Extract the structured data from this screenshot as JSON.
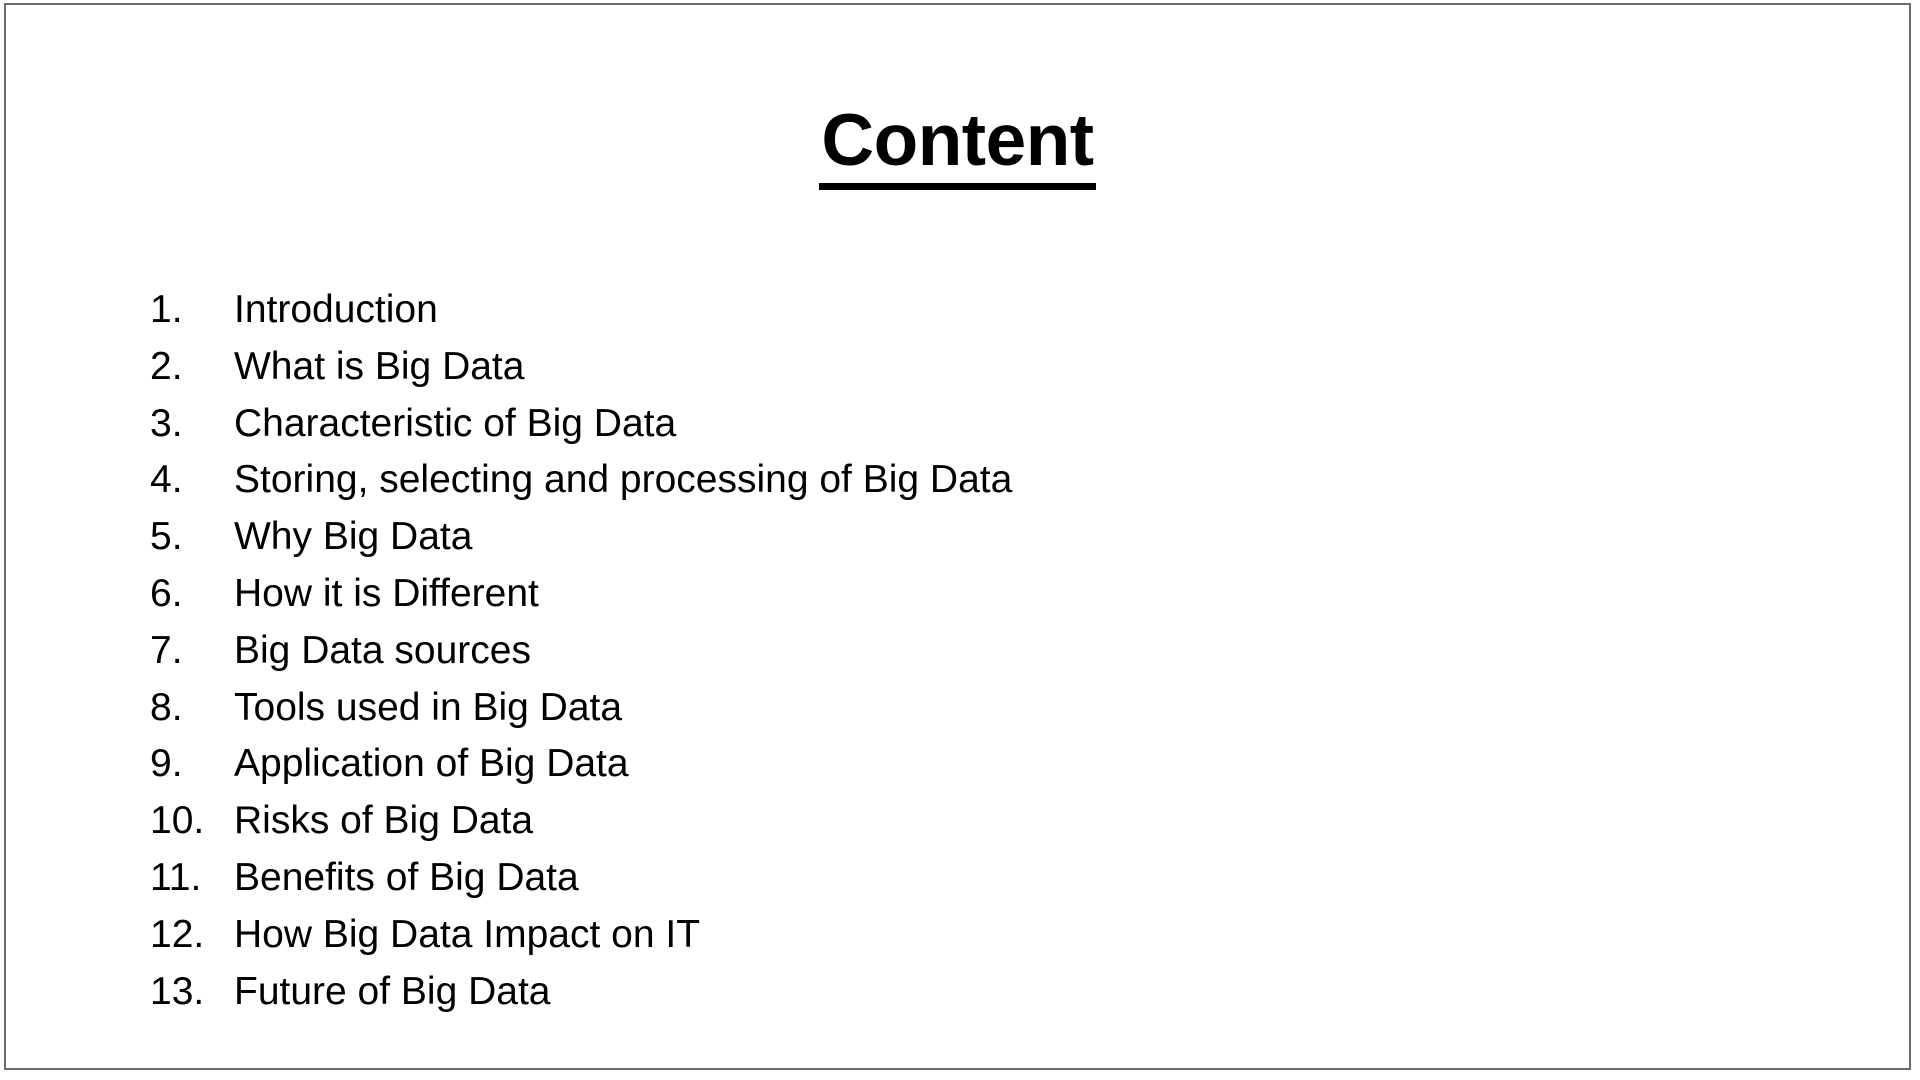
{
  "slide": {
    "background_color": "#ffffff",
    "border_color": "#6b6b70",
    "text_color": "#000000",
    "title": "Content",
    "items": [
      {
        "number": "1.",
        "label": "Introduction"
      },
      {
        "number": "2.",
        "label": "What is Big Data"
      },
      {
        "number": "3.",
        "label": "Characteristic of Big Data"
      },
      {
        "number": "4.",
        "label": "Storing, selecting and processing of Big Data"
      },
      {
        "number": "5.",
        "label": "Why Big Data"
      },
      {
        "number": "6.",
        "label": "How it is Different"
      },
      {
        "number": "7.",
        "label": "Big Data sources"
      },
      {
        "number": "8.",
        "label": "Tools used in Big Data"
      },
      {
        "number": "9.",
        "label": "Application of Big Data"
      },
      {
        "number": "10.",
        "label": "Risks of Big Data"
      },
      {
        "number": "11.",
        "label": "Benefits of Big Data"
      },
      {
        "number": "12.",
        "label": "How Big Data Impact on IT"
      },
      {
        "number": "13.",
        "label": "Future of Big Data"
      }
    ]
  }
}
